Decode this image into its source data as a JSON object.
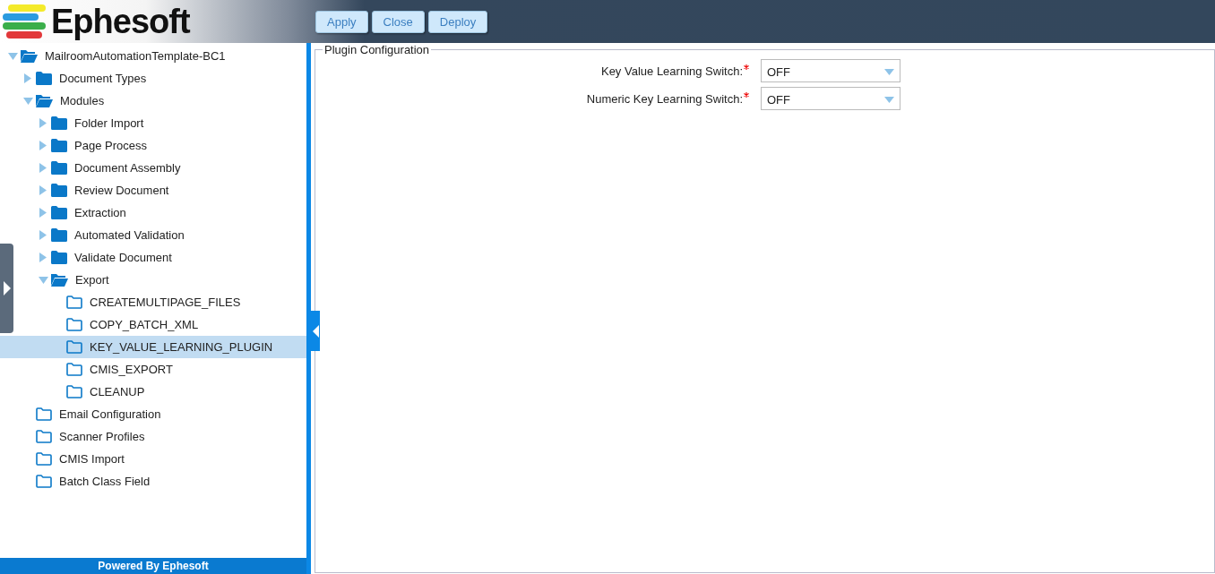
{
  "header": {
    "logo_text": "Ephesoft",
    "buttons": [
      "Apply",
      "Close",
      "Deploy"
    ]
  },
  "tree": [
    {
      "label": "MailroomAutomationTemplate-BC1",
      "kind": "branch",
      "expanded": true,
      "selected": false,
      "children": [
        {
          "label": "Document Types",
          "kind": "branch",
          "expanded": false,
          "selected": false
        },
        {
          "label": "Modules",
          "kind": "branch",
          "expanded": true,
          "selected": false,
          "children": [
            {
              "label": "Folder Import",
              "kind": "branch",
              "expanded": false,
              "selected": false
            },
            {
              "label": "Page Process",
              "kind": "branch",
              "expanded": false,
              "selected": false
            },
            {
              "label": "Document Assembly",
              "kind": "branch",
              "expanded": false,
              "selected": false
            },
            {
              "label": "Review Document",
              "kind": "branch",
              "expanded": false,
              "selected": false
            },
            {
              "label": "Extraction",
              "kind": "branch",
              "expanded": false,
              "selected": false
            },
            {
              "label": "Automated Validation",
              "kind": "branch",
              "expanded": false,
              "selected": false
            },
            {
              "label": "Validate Document",
              "kind": "branch",
              "expanded": false,
              "selected": false
            },
            {
              "label": "Export",
              "kind": "branch",
              "expanded": true,
              "selected": false,
              "children": [
                {
                  "label": "CREATEMULTIPAGE_FILES",
                  "kind": "leaf",
                  "selected": false
                },
                {
                  "label": "COPY_BATCH_XML",
                  "kind": "leaf",
                  "selected": false
                },
                {
                  "label": "KEY_VALUE_LEARNING_PLUGIN",
                  "kind": "leaf",
                  "selected": true
                },
                {
                  "label": "CMIS_EXPORT",
                  "kind": "leaf",
                  "selected": false
                },
                {
                  "label": "CLEANUP",
                  "kind": "leaf",
                  "selected": false
                }
              ]
            }
          ]
        },
        {
          "label": "Email Configuration",
          "kind": "leaf",
          "selected": false
        },
        {
          "label": "Scanner Profiles",
          "kind": "leaf",
          "selected": false
        },
        {
          "label": "CMIS Import",
          "kind": "leaf",
          "selected": false
        },
        {
          "label": "Batch Class Field",
          "kind": "leaf",
          "selected": false
        }
      ]
    }
  ],
  "footer": "Powered By Ephesoft",
  "panel": {
    "legend": "Plugin Configuration",
    "fields": [
      {
        "label": "Key Value Learning Switch:",
        "required": true,
        "value": "OFF"
      },
      {
        "label": "Numeric Key Learning Switch:",
        "required": true,
        "value": "OFF"
      }
    ]
  }
}
